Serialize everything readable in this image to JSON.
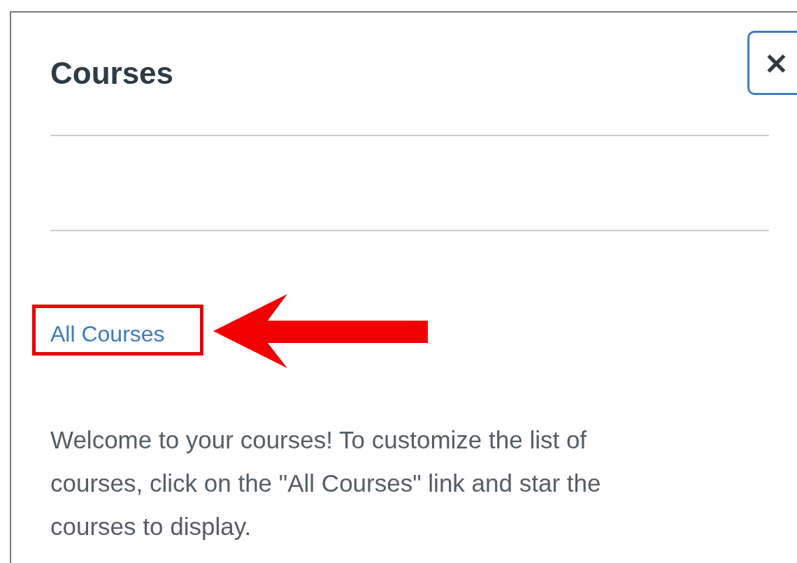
{
  "panel": {
    "title": "Courses",
    "close_label": "×"
  },
  "link": {
    "label": "All Courses"
  },
  "message": "Welcome to your courses! To customize the list of courses, click on the \"All Courses\" link and star the courses to display.",
  "annotations": {
    "highlight_box": true,
    "arrow": true
  }
}
